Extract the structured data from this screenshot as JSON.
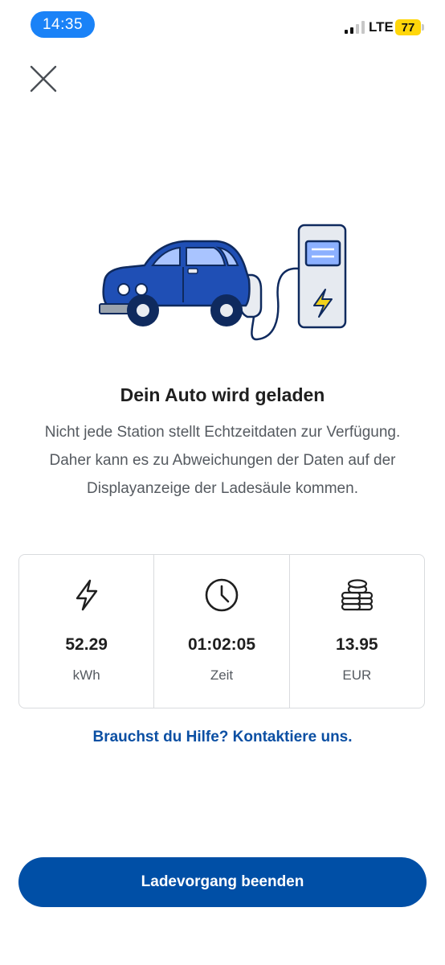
{
  "status_bar": {
    "time": "14:35",
    "network": "LTE",
    "battery": "77"
  },
  "icons": {
    "close": "close-icon",
    "signal": "signal-bars-icon",
    "illustration": "car-charging-illustration",
    "energy": "lightning-icon",
    "time": "clock-icon",
    "cost": "coins-icon"
  },
  "content": {
    "title": "Dein Auto wird geladen",
    "description": "Nicht jede Station stellt Echtzeitdaten zur Verfügung. Daher kann es zu Abweichungen der Daten auf der Displayanzeige der Ladesäule kommen."
  },
  "stats": [
    {
      "value": "52.29",
      "unit": "kWh"
    },
    {
      "value": "01:02:05",
      "unit": "Zeit"
    },
    {
      "value": "13.95",
      "unit": "EUR"
    }
  ],
  "help_link": "Brauchst du Hilfe? Kontaktiere uns.",
  "end_button": "Ladevorgang beenden",
  "colors": {
    "primary": "#004fa6",
    "link": "#0b4fa3",
    "time_pill": "#1a82f7",
    "battery": "#ffd60a",
    "car_blue": "#1f4fb5"
  }
}
